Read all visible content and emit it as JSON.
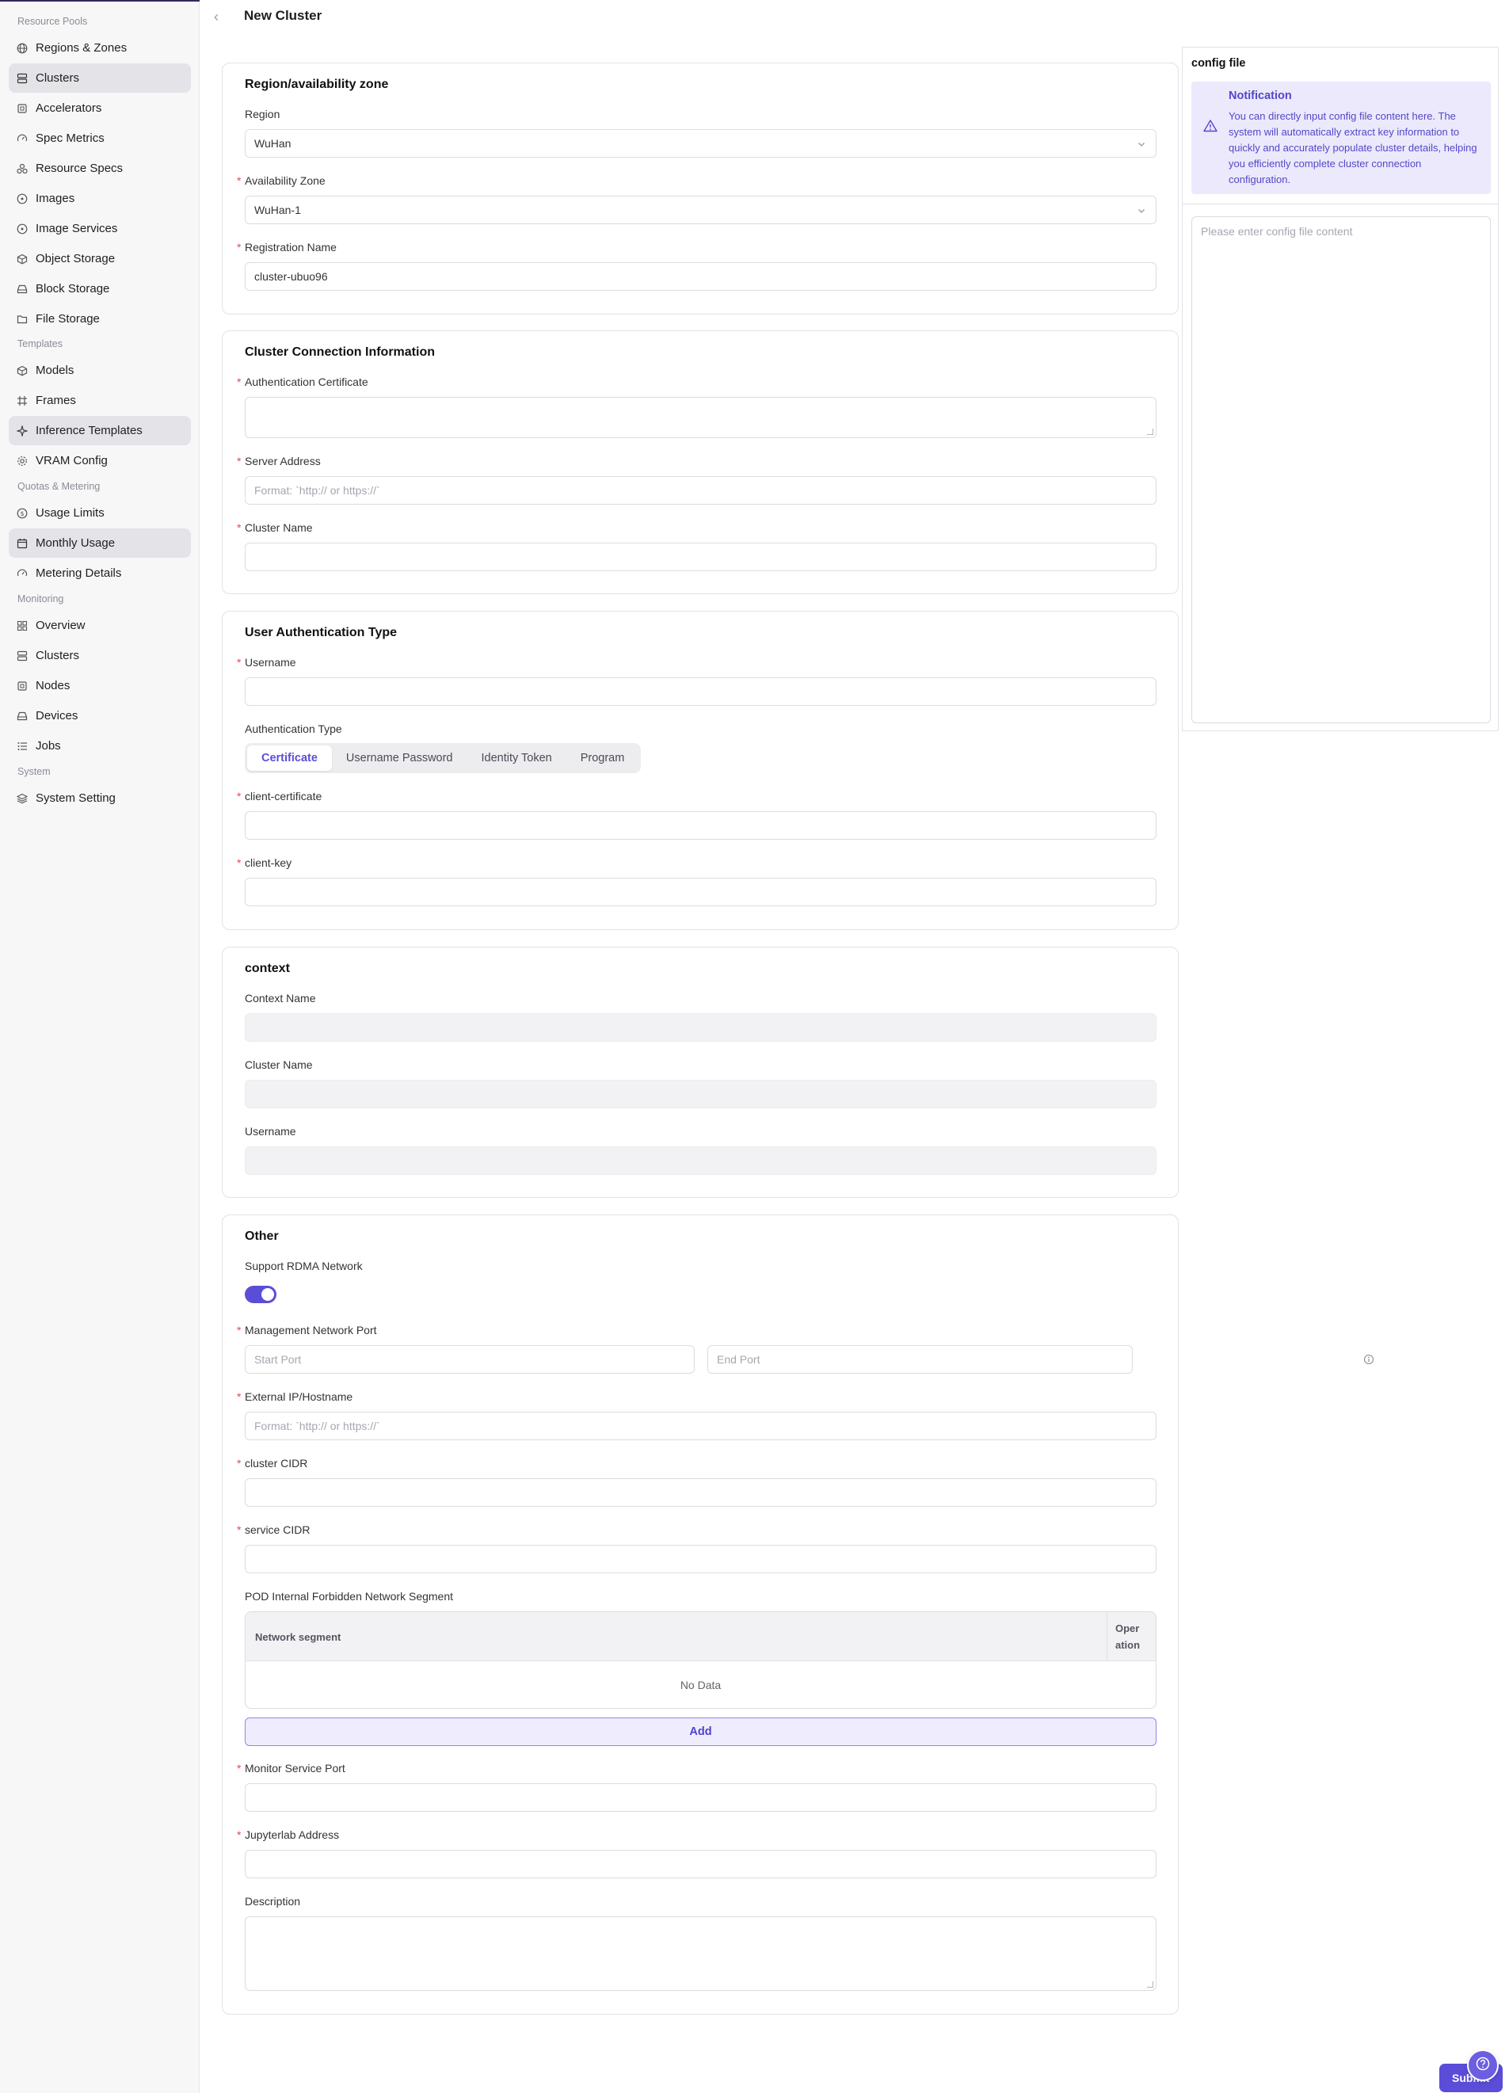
{
  "page": {
    "title": "New Cluster"
  },
  "sidebar": {
    "groups": [
      {
        "label": "Resource Pools",
        "items": [
          "Regions & Zones",
          "Clusters",
          "Accelerators",
          "Spec Metrics",
          "Resource Specs",
          "Images",
          "Image Services",
          "Object Storage",
          "Block Storage",
          "File Storage"
        ]
      },
      {
        "label": "Templates",
        "items": [
          "Models",
          "Frames",
          "Inference Templates",
          "VRAM Config"
        ]
      },
      {
        "label": "Quotas & Metering",
        "items": [
          "Usage Limits",
          "Monthly Usage",
          "Metering Details"
        ]
      },
      {
        "label": "Monitoring",
        "items": [
          "Overview",
          "Clusters",
          "Nodes",
          "Devices",
          "Jobs"
        ]
      },
      {
        "label": "System",
        "items": [
          "System Setting"
        ]
      }
    ],
    "highlighted": [
      "Clusters",
      "Inference Templates",
      "Monthly Usage"
    ]
  },
  "region_section": {
    "title": "Region/availability zone",
    "region_label": "Region",
    "region_value": "WuHan",
    "zone_label": "Availability Zone",
    "zone_value": "WuHan-1",
    "registration_label": "Registration Name",
    "registration_value": "cluster-ubuo96"
  },
  "connection_section": {
    "title": "Cluster Connection Information",
    "auth_cert_label": "Authentication Certificate",
    "server_address_label": "Server Address",
    "server_address_placeholder": "Format: `http:// or https://`",
    "cluster_name_label": "Cluster Name"
  },
  "user_auth_section": {
    "title": "User Authentication Type",
    "username_label": "Username",
    "auth_type_label": "Authentication Type",
    "auth_types": [
      "Certificate",
      "Username Password",
      "Identity Token",
      "Program"
    ],
    "selected_auth_type": "Certificate",
    "client_cert_label": "client-certificate",
    "client_key_label": "client-key"
  },
  "context_section": {
    "title": "context",
    "context_name_label": "Context Name",
    "cluster_name_label": "Cluster Name",
    "username_label": "Username"
  },
  "other_section": {
    "title": "Other",
    "rdma_label": "Support RDMA Network",
    "rdma_enabled": true,
    "mgmt_port_label": "Management Network Port",
    "start_port_placeholder": "Start Port",
    "port_separator": "-",
    "end_port_placeholder": "End Port",
    "external_ip_label": "External IP/Hostname",
    "external_ip_placeholder": "Format: `http:// or https://`",
    "cluster_cidr_label": "cluster CIDR",
    "service_cidr_label": "service CIDR",
    "pod_segment_label": "POD Internal Forbidden Network Segment",
    "table_columns": [
      "Network segment",
      "Oper ation"
    ],
    "table_empty": "No Data",
    "add_label": "Add",
    "monitor_port_label": "Monitor Service Port",
    "jupyterlab_label": "Jupyterlab Address",
    "description_label": "Description"
  },
  "config_panel": {
    "title": "config file",
    "notice_title": "Notification",
    "notice_text": "You can directly input config file content here. The system will automatically extract key information to quickly and accurately populate cluster details, helping you efficiently complete cluster connection configuration.",
    "textarea_placeholder": "Please enter config file content"
  },
  "footer": {
    "submit_label": "Submit"
  },
  "colors": {
    "accent": "#5b4dd8",
    "notice_bg": "#ebe9fb",
    "required": "#e5484d",
    "sidebar_bg": "#f7f7f8"
  }
}
